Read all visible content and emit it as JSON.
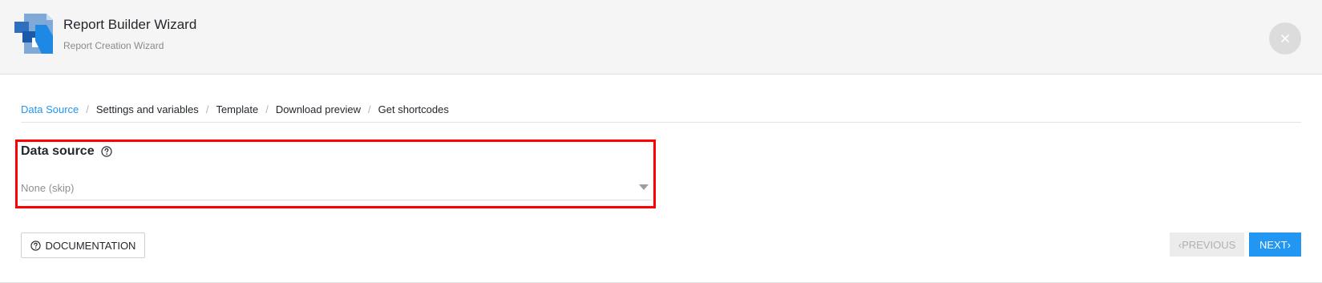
{
  "header": {
    "title": "Report Builder Wizard",
    "subtitle": "Report Creation Wizard",
    "logo_icon": "report-builder-logo",
    "close_icon": "close-icon"
  },
  "breadcrumb": {
    "steps": [
      "Data Source",
      "Settings and variables",
      "Template",
      "Download preview",
      "Get shortcodes"
    ],
    "separator": "/",
    "active_index": 0
  },
  "form": {
    "data_source": {
      "label": "Data source",
      "value": "None (skip)",
      "help_icon": "question-circle-icon"
    }
  },
  "footer": {
    "documentation_label": "DOCUMENTATION",
    "previous_label": "PREVIOUS",
    "next_label": "NEXT"
  },
  "colors": {
    "accent": "#2196f3",
    "highlight_border": "#ff0000",
    "header_bg": "#f5f5f5"
  }
}
